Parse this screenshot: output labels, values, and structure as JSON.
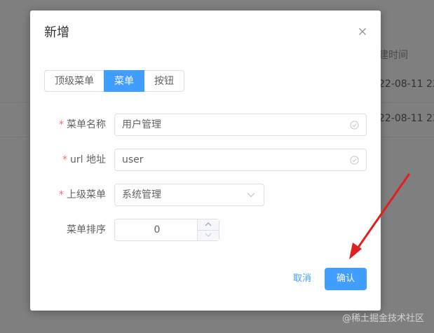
{
  "background": {
    "column_header": "建时间",
    "rows": [
      {
        "date": "22-08-11 22"
      },
      {
        "date": "22-08-11 22"
      }
    ]
  },
  "dialog": {
    "title": "新增",
    "close_icon": "close-icon",
    "type_tabs": [
      {
        "label": "顶级菜单",
        "active": false
      },
      {
        "label": "菜单",
        "active": true
      },
      {
        "label": "按钮",
        "active": false
      }
    ],
    "fields": {
      "menu_name": {
        "label": "菜单名称",
        "required": true,
        "value": "用户管理"
      },
      "url": {
        "label": "url 地址",
        "required": true,
        "value": "user"
      },
      "parent_menu": {
        "label": "上级菜单",
        "required": true,
        "value": "系统管理"
      },
      "sort_order": {
        "label": "菜单排序",
        "required": false,
        "value": "0"
      }
    },
    "footer": {
      "cancel_label": "取消",
      "confirm_label": "确认"
    }
  },
  "colors": {
    "primary": "#409eff",
    "required_star": "#f56c6c",
    "annotation_arrow": "#e02020"
  },
  "watermark": "@稀土掘金技术社区"
}
